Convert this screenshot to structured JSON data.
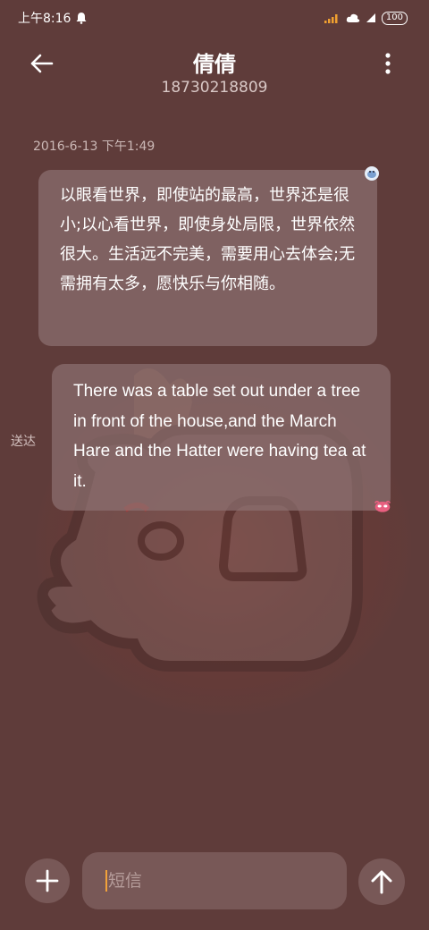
{
  "status_bar": {
    "time": "上午8:16",
    "battery": "100"
  },
  "header": {
    "title": "倩倩",
    "subtitle": "18730218809"
  },
  "conversation": {
    "timestamp": "2016-6-13 下午1:49",
    "messages": [
      {
        "direction": "incoming",
        "text": "以眼看世界，即使站的最高，世界还是很小;以心看世界，即使身处局限，世界依然很大。生活远不完美，需要用心去体会;无需拥有太多，愿快乐与你相随。"
      },
      {
        "direction": "outgoing",
        "text": "There was a table set out under a tree in front of the house,and the March Hare and the Hatter were having tea at it.",
        "status": "送达"
      }
    ]
  },
  "composer": {
    "placeholder": "短信",
    "value": ""
  },
  "icons": {
    "back": "arrow-left-icon",
    "more": "more-vertical-icon",
    "add": "plus-icon",
    "send": "arrow-up-icon"
  },
  "colors": {
    "background": "#5f3c3a",
    "bubble": "#8c7070",
    "caret": "#f2a23a"
  }
}
